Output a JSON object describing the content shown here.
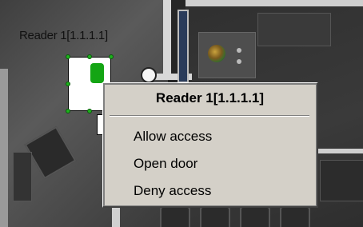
{
  "reader": {
    "label": "Reader 1[1.1.1.1]",
    "indicator_color": "#14a514"
  },
  "context_menu": {
    "title": "Reader 1[1.1.1.1]",
    "items": [
      {
        "label": "Allow access"
      },
      {
        "label": "Open door"
      },
      {
        "label": "Deny access"
      }
    ]
  }
}
